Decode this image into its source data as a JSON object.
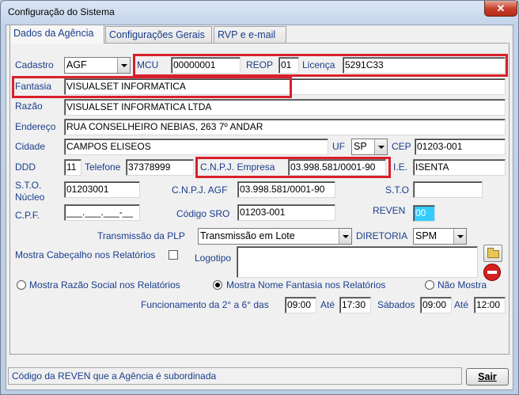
{
  "window": {
    "title": "Configuração do Sistema",
    "close_glyph": "✕"
  },
  "tabs": [
    {
      "label": "Dados da Agência"
    },
    {
      "label": "Configurações Gerais"
    },
    {
      "label": "RVP e e-mail"
    }
  ],
  "form": {
    "cadastro": {
      "label": "Cadastro",
      "value": "AGF"
    },
    "mcu": {
      "label": "MCU",
      "value": "00000001"
    },
    "reop": {
      "label": "REOP",
      "value": "01"
    },
    "licenca": {
      "label": "Licença",
      "value": "5291C33"
    },
    "fantasia": {
      "label": "Fantasia",
      "value": "VISUALSET INFORMATICA"
    },
    "razao": {
      "label": "Razão",
      "value": "VISUALSET INFORMATICA LTDA"
    },
    "endereco": {
      "label": "Endereço",
      "value": "RUA CONSELHEIRO NEBIAS, 263 7º ANDAR"
    },
    "cidade": {
      "label": "Cidade",
      "value": "CAMPOS ELISEOS"
    },
    "uf": {
      "label": "UF",
      "value": "SP"
    },
    "cep": {
      "label": "CEP",
      "value": "01203-001"
    },
    "ddd": {
      "label": "DDD",
      "value": "11"
    },
    "telefone": {
      "label": "Telefone",
      "value": "37378999"
    },
    "cnpj_empresa": {
      "label": "C.N.P.J. Empresa",
      "value": "03.998.581/0001-90"
    },
    "ie": {
      "label": "I.E.",
      "value": "ISENTA"
    },
    "sto_nucleo": {
      "label_1": "S.T.O.",
      "label_2": "Núcleo",
      "value": "01203001"
    },
    "cnpj_agf": {
      "label": "C.N.P.J. AGF",
      "value": "03.998.581/0001-90"
    },
    "sto": {
      "label": "S.T.O",
      "value": ""
    },
    "cpf": {
      "label": "C.P.F.",
      "value": "___.___.___-__"
    },
    "codigo_sro": {
      "label": "Código SRO",
      "value": "01203-001"
    },
    "reven": {
      "label": "REVEN",
      "value": "00",
      "color": "#33ccff"
    },
    "transmissao": {
      "label": "Transmissão da PLP",
      "value": "Transmissão em Lote"
    },
    "diretoria": {
      "label": "DIRETORIA",
      "value": "SPM"
    },
    "mostra_cabecalho": {
      "label": "Mostra Cabeçalho nos Relatórios",
      "checked": false
    },
    "logotipo": {
      "label": "Logotipo",
      "value": ""
    },
    "radios": [
      {
        "label": "Mostra Razão Social nos Relatórios",
        "selected": false
      },
      {
        "label": "Mostra Nome Fantasia nos Relatórios",
        "selected": true
      },
      {
        "label": "Não Mostra",
        "selected": false
      }
    ],
    "funcionamento": {
      "label": "Funcionamento da 2° a 6° das",
      "weekday_from": "09:00",
      "ate_label": "Até",
      "weekday_to": "17:30",
      "sabados_label": "Sábados",
      "sat_from": "09:00",
      "ate_label_2": "Até",
      "sat_to": "12:00"
    }
  },
  "status": {
    "text": "Código da REVEN que a Agência é subordinada"
  },
  "buttons": {
    "sair": "Sair"
  },
  "icons": [
    "open-folder-icon",
    "stop-delete-icon"
  ],
  "colors": {
    "highlight_box": "#d9202a",
    "label_blue": "#1a3d8c"
  }
}
